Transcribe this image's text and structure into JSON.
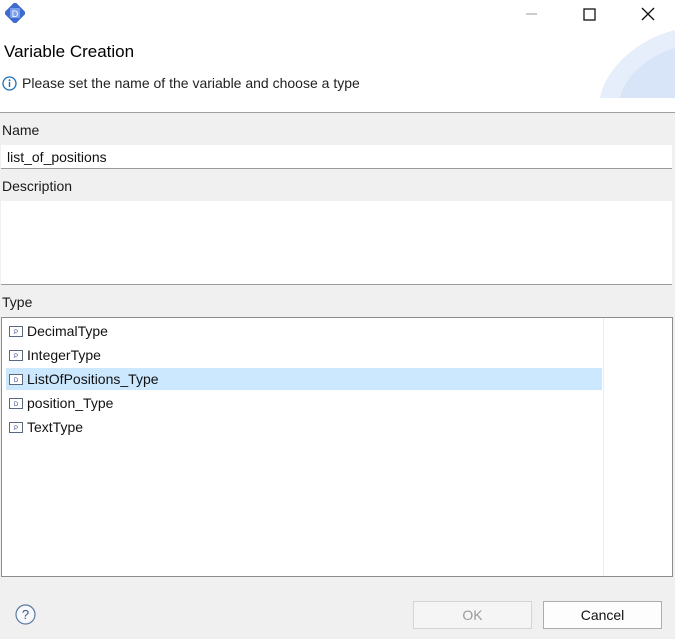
{
  "window": {
    "title_bar": ""
  },
  "header": {
    "title": "Variable Creation",
    "message": "Please set the name of the variable and choose a type"
  },
  "form": {
    "name_label": "Name",
    "name_value": "list_of_positions",
    "description_label": "Description",
    "description_value": "",
    "type_label": "Type",
    "types": [
      {
        "label": "DecimalType",
        "icon": "primitive-type-icon",
        "selected": false
      },
      {
        "label": "IntegerType",
        "icon": "primitive-type-icon",
        "selected": false
      },
      {
        "label": "ListOfPositions_Type",
        "icon": "data-type-icon",
        "selected": true
      },
      {
        "label": "position_Type",
        "icon": "data-type-icon",
        "selected": false
      },
      {
        "label": "TextType",
        "icon": "primitive-type-icon",
        "selected": false
      }
    ]
  },
  "footer": {
    "ok_label": "OK",
    "cancel_label": "Cancel",
    "ok_enabled": false
  },
  "colors": {
    "selection": "#cce8ff",
    "info": "#1e6fb8",
    "app_icon": "#3f6bd1"
  }
}
